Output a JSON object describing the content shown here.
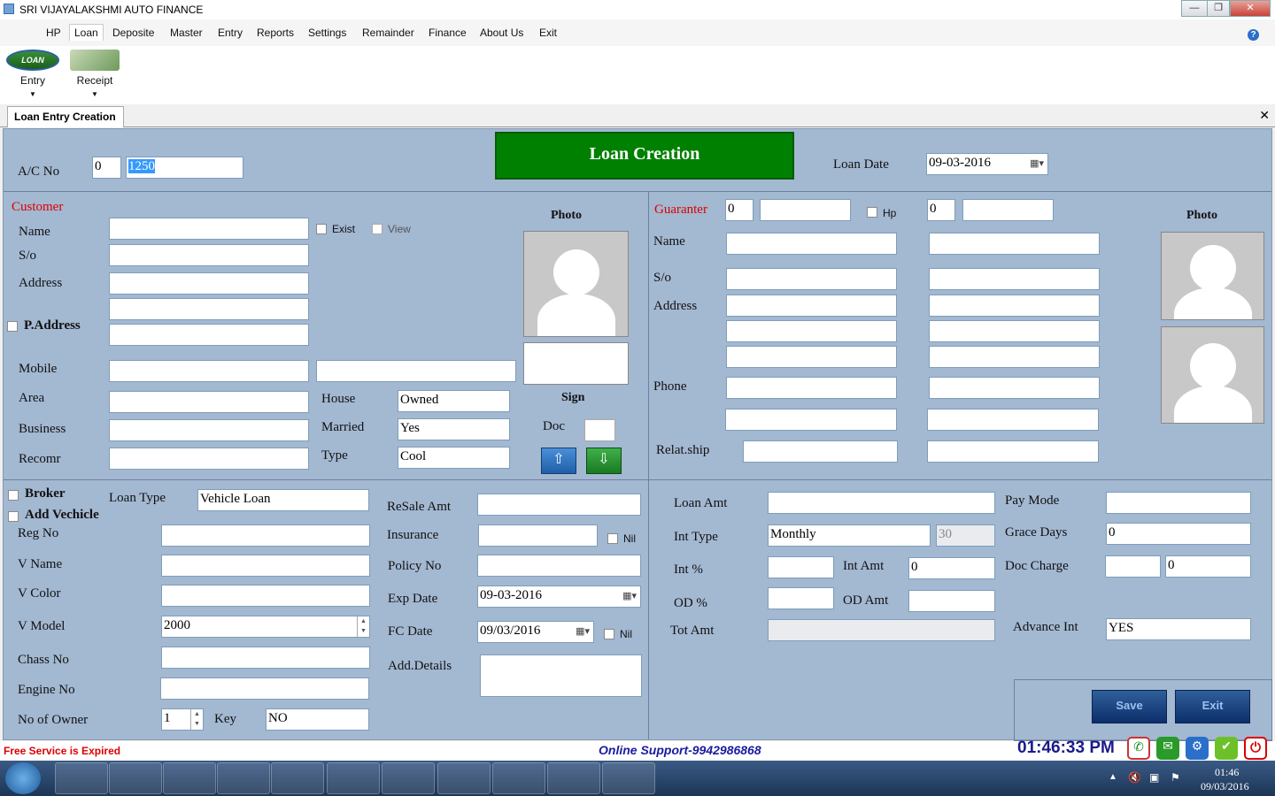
{
  "window": {
    "title": "SRI VIJAYALAKSHMI AUTO FINANCE",
    "minimize": "—",
    "maximize": "❐",
    "close": "✕"
  },
  "menu": [
    "HP",
    "Loan",
    "Deposite",
    "Master",
    "Entry",
    "Reports",
    "Settings",
    "Remainder",
    "Finance",
    "About Us",
    "Exit"
  ],
  "ribbon": {
    "entry": "Entry",
    "receipt": "Receipt",
    "loan_logo": "LOAN"
  },
  "tab": {
    "title": "Loan Entry Creation",
    "close": "✕"
  },
  "header": {
    "banner": "Loan Creation",
    "ac_label": "A/C No",
    "ac_prefix": "0",
    "ac_no": "1250",
    "loan_date_label": "Loan Date",
    "loan_date": "09-03-2016"
  },
  "customer": {
    "section": "Customer",
    "name": "Name",
    "so": "S/o",
    "address": "Address",
    "paddress": "P.Address",
    "mobile": "Mobile",
    "area": "Area",
    "business": "Business",
    "recomr": "Recomr",
    "exist": "Exist",
    "view": "View",
    "house_label": "House",
    "house": "Owned",
    "married_label": "Married",
    "married": "Yes",
    "type_label": "Type",
    "type": "Cool",
    "photo": "Photo",
    "sign": "Sign",
    "doc": "Doc"
  },
  "guarantor": {
    "section": "Guaranter",
    "id1": "0",
    "hp": "Hp",
    "id2": "0",
    "name": "Name",
    "so": "S/o",
    "address": "Address",
    "phone": "Phone",
    "relat": "Relat.ship",
    "photo": "Photo"
  },
  "vehicle": {
    "broker": "Broker",
    "add_vehicle": "Add Vechicle",
    "loan_type_label": "Loan Type",
    "loan_type": "Vehicle Loan",
    "reg_no": "Reg No",
    "v_name": "V Name",
    "v_color": "V Color",
    "v_model_label": "V Model",
    "v_model": "2000",
    "chass_no": "Chass No",
    "engine_no": "Engine No",
    "owners_label": "No of Owner",
    "owners": "1",
    "key_label": "Key",
    "key": "NO",
    "resale": "ReSale Amt",
    "insurance": "Insurance",
    "nil": "Nil",
    "policy": "Policy No",
    "exp_label": "Exp Date",
    "exp_date": "09-03-2016",
    "fc_label": "FC Date",
    "fc_date": "09/03/2016",
    "nil2": "Nil",
    "add_details": "Add.Details"
  },
  "loan": {
    "loan_amt": "Loan Amt",
    "int_type_label": "Int Type",
    "int_type": "Monthly",
    "int_days": "30",
    "int_pct": "Int %",
    "int_amt_label": "Int Amt",
    "int_amt": "0",
    "od_pct": "OD %",
    "od_amt": "OD Amt",
    "tot_amt": "Tot Amt",
    "pay_mode": "Pay Mode",
    "grace_label": "Grace Days",
    "grace": "0",
    "doc_charge_label": "Doc Charge",
    "doc_charge": "0",
    "adv_label": "Advance Int",
    "adv": "YES",
    "save": "Save",
    "exit": "Exit"
  },
  "status": {
    "expired": "Free Service is Expired",
    "support": "Online Support-9942986868",
    "clock": "01:46:33 PM"
  },
  "tray": {
    "time": "01:46",
    "date": "09/03/2016"
  }
}
